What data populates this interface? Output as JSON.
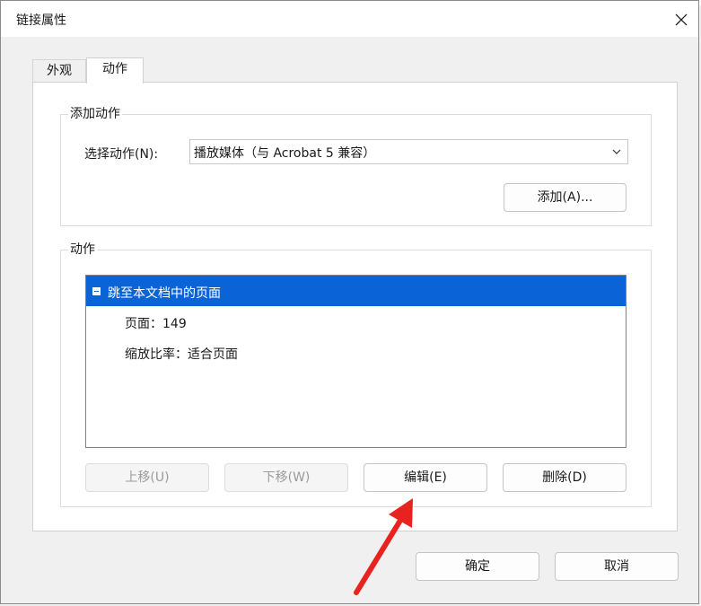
{
  "dialog": {
    "title": "链接属性",
    "close_icon": "close-icon"
  },
  "tabs": [
    {
      "label": "外观",
      "active": false
    },
    {
      "label": "动作",
      "active": true
    }
  ],
  "add_action": {
    "group_label": "添加动作",
    "select_label": "选择动作(N):",
    "select_value": "播放媒体（与 Acrobat 5 兼容）",
    "add_button": "添加(A)..."
  },
  "actions": {
    "group_label": "动作",
    "items": [
      {
        "label": "跳至本文档中的页面",
        "selected": true,
        "expanded": true
      }
    ],
    "details": [
      "页面：149",
      "缩放比率：适合页面"
    ],
    "buttons": {
      "up": "上移(U)",
      "down": "下移(W)",
      "edit": "编辑(E)",
      "delete": "删除(D)"
    }
  },
  "footer": {
    "ok": "确定",
    "cancel": "取消"
  },
  "colors": {
    "selection": "#0a64d8",
    "annotation_arrow": "#e8231f"
  }
}
